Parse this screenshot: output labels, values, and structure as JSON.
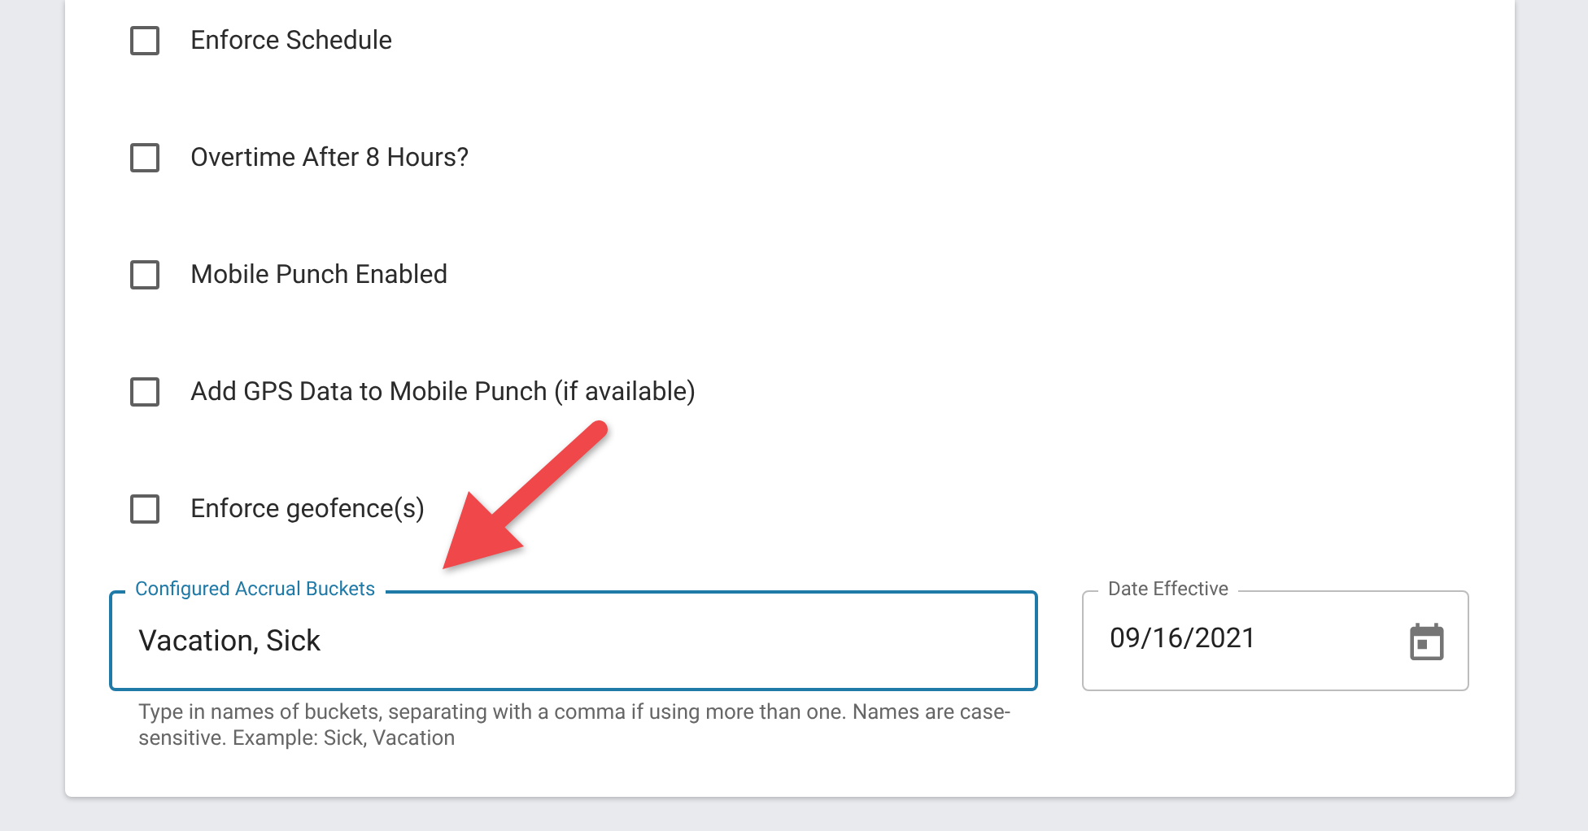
{
  "checkboxes": [
    {
      "label": "Enforce Schedule",
      "checked": false
    },
    {
      "label": "Overtime After 8 Hours?",
      "checked": false
    },
    {
      "label": "Mobile Punch Enabled",
      "checked": false
    },
    {
      "label": "Add GPS Data to Mobile Punch (if available)",
      "checked": false
    },
    {
      "label": "Enforce geofence(s)",
      "checked": false
    }
  ],
  "accrual_field": {
    "label": "Configured Accrual Buckets",
    "value": "Vacation, Sick",
    "focused": true,
    "helper": "Type in names of buckets, separating with a comma if using more than one. Names are case-sensitive. Example: Sick, Vacation"
  },
  "date_field": {
    "label": "Date Effective",
    "value": "09/16/2021"
  }
}
